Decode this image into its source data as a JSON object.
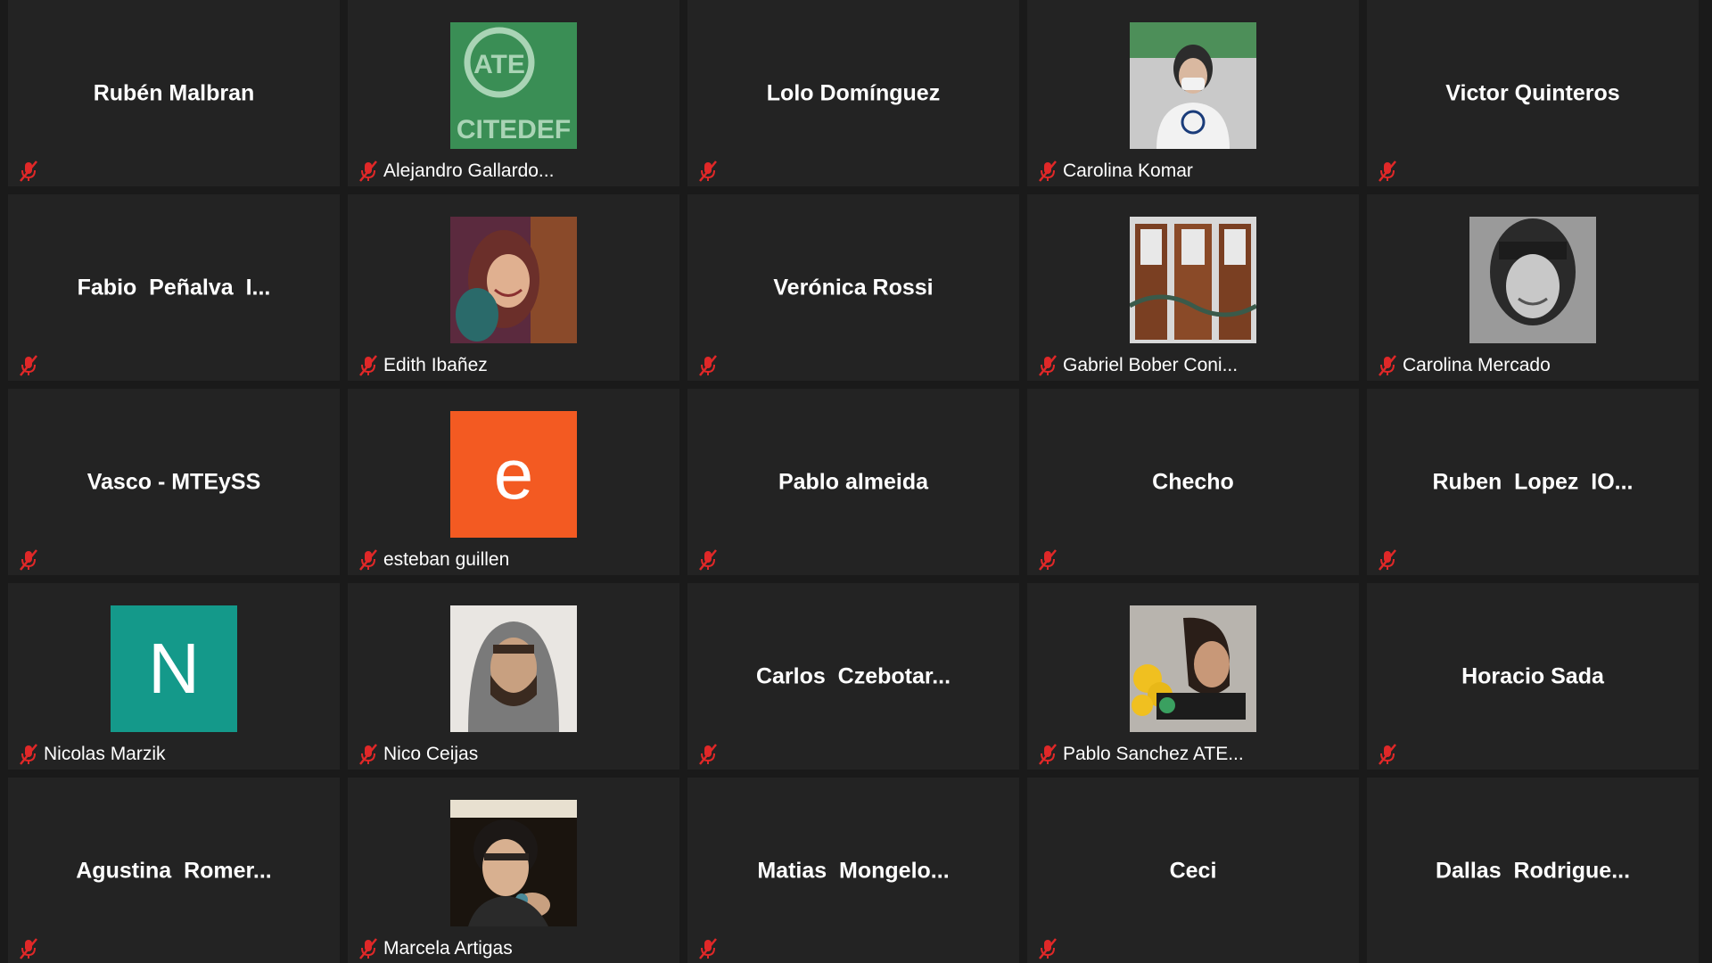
{
  "colors": {
    "background": "#1a1a1a",
    "tile": "#232323",
    "muted_mic": "#e02828",
    "orange_avatar": "#f35a22",
    "teal_avatar": "#14998a"
  },
  "participants": [
    {
      "id": "p1",
      "display": "Rubén Malbran",
      "label": "",
      "avatar": "none",
      "mic": "muted-mic-icon"
    },
    {
      "id": "p2",
      "display": "",
      "label": "Alejandro Gallardo...",
      "avatar": "ate-citedef-logo",
      "mic": "muted-mic-icon"
    },
    {
      "id": "p3",
      "display": "Lolo Domínguez",
      "label": "",
      "avatar": "none",
      "mic": "muted-mic-icon"
    },
    {
      "id": "p4",
      "display": "",
      "label": "Carolina Komar",
      "avatar": "photo",
      "mic": "muted-mic-icon"
    },
    {
      "id": "p5",
      "display": "Victor Quinteros",
      "label": "",
      "avatar": "none",
      "mic": "muted-mic-icon"
    },
    {
      "id": "p6",
      "display": "Fabio  Peñalva  I...",
      "label": "",
      "avatar": "none",
      "mic": "muted-mic-icon"
    },
    {
      "id": "p7",
      "display": "",
      "label": "Edith Ibañez",
      "avatar": "photo",
      "mic": "muted-mic-icon"
    },
    {
      "id": "p8",
      "display": "Verónica Rossi",
      "label": "",
      "avatar": "none",
      "mic": "muted-mic-icon"
    },
    {
      "id": "p9",
      "display": "",
      "label": "Gabriel Bober Coni...",
      "avatar": "photo",
      "mic": "muted-mic-icon"
    },
    {
      "id": "p10",
      "display": "",
      "label": "Carolina Mercado",
      "avatar": "photo",
      "mic": "muted-mic-icon"
    },
    {
      "id": "p11",
      "display": "Vasco - MTEySS",
      "label": "",
      "avatar": "none",
      "mic": "muted-mic-icon"
    },
    {
      "id": "p12",
      "display": "",
      "label": "esteban guillen",
      "avatar": "letter",
      "avatar_letter": "e",
      "mic": "muted-mic-icon"
    },
    {
      "id": "p13",
      "display": "Pablo almeida",
      "label": "",
      "avatar": "none",
      "mic": "muted-mic-icon"
    },
    {
      "id": "p14",
      "display": "Checho",
      "label": "",
      "avatar": "none",
      "mic": "muted-mic-icon"
    },
    {
      "id": "p15",
      "display": "Ruben  Lopez  IO...",
      "label": "",
      "avatar": "none",
      "mic": "muted-mic-icon"
    },
    {
      "id": "p16",
      "display": "",
      "label": "Nicolas Marzik",
      "avatar": "letter",
      "avatar_letter": "N",
      "mic": "muted-mic-icon"
    },
    {
      "id": "p17",
      "display": "",
      "label": "Nico Ceijas",
      "avatar": "photo",
      "mic": "muted-mic-icon"
    },
    {
      "id": "p18",
      "display": "Carlos  Czebotar...",
      "label": "",
      "avatar": "none",
      "mic": "muted-mic-icon"
    },
    {
      "id": "p19",
      "display": "",
      "label": "Pablo Sanchez ATE...",
      "avatar": "photo",
      "mic": "muted-mic-icon"
    },
    {
      "id": "p20",
      "display": "Horacio Sada",
      "label": "",
      "avatar": "none",
      "mic": "muted-mic-icon"
    },
    {
      "id": "p21",
      "display": "Agustina  Romer...",
      "label": "",
      "avatar": "none",
      "mic": "muted-mic-icon"
    },
    {
      "id": "p22",
      "display": "",
      "label": "Marcela Artigas",
      "avatar": "photo",
      "mic": "muted-mic-icon"
    },
    {
      "id": "p23",
      "display": "Matias  Mongelo...",
      "label": "",
      "avatar": "none",
      "mic": "muted-mic-icon"
    },
    {
      "id": "p24",
      "display": "Ceci",
      "label": "",
      "avatar": "none",
      "mic": "muted-mic-icon"
    },
    {
      "id": "p25",
      "display": "Dallas  Rodrigue...",
      "label": "",
      "avatar": "none",
      "mic": "none"
    }
  ],
  "logo_text": {
    "ate": "ATE",
    "citedef": "CITEDEF"
  }
}
